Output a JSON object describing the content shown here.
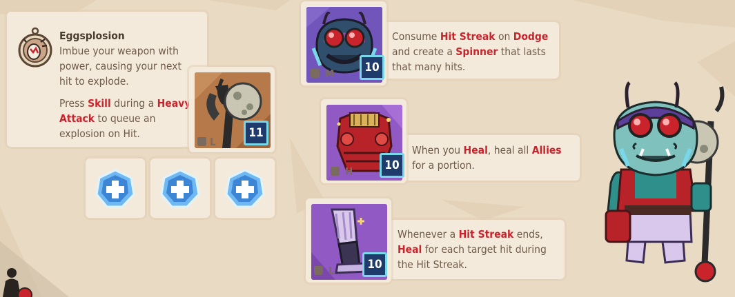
{
  "ability": {
    "title": "Eggsplosion",
    "desc": "Imbue your weapon with power, causing your next hit to explode.",
    "press_pre": "Press ",
    "press_skill": "Skill",
    "press_mid": " during a ",
    "press_heavy": "Heavy Attack",
    "press_post": " to queue an explosion on Hit.",
    "weapon": {
      "weight": "L",
      "level": "11",
      "icon": "egg-mace-weapon-icon"
    }
  },
  "gem_slots": [
    {
      "icon": "blue-plus-gem-icon"
    },
    {
      "icon": "blue-plus-gem-icon"
    },
    {
      "icon": "blue-plus-gem-icon"
    }
  ],
  "gear": [
    {
      "name": "helmet",
      "weight": "M",
      "level": "10",
      "icon": "goggles-helmet-icon",
      "segments": [
        {
          "t": "Consume ",
          "h": false
        },
        {
          "t": "Hit Streak",
          "h": true
        },
        {
          "t": " on ",
          "h": false
        },
        {
          "t": "Dodge",
          "h": true
        },
        {
          "t": " and create a ",
          "h": false
        },
        {
          "t": "Spinner",
          "h": true
        },
        {
          "t": " that lasts that many hits.",
          "h": false
        }
      ]
    },
    {
      "name": "chest",
      "weight": "H",
      "level": "10",
      "icon": "red-armor-chest-icon",
      "segments": [
        {
          "t": "When you ",
          "h": false
        },
        {
          "t": "Heal",
          "h": true
        },
        {
          "t": ", heal all ",
          "h": false
        },
        {
          "t": "Allies",
          "h": true
        },
        {
          "t": " for a portion.",
          "h": false
        }
      ]
    },
    {
      "name": "boots",
      "weight": "L",
      "level": "10",
      "icon": "fur-boots-icon",
      "segments": [
        {
          "t": "Whenever a ",
          "h": false
        },
        {
          "t": "Hit Streak",
          "h": true
        },
        {
          "t": " ends, ",
          "h": false
        },
        {
          "t": "Heal",
          "h": true
        },
        {
          "t": " for each target hit during the Hit Streak.",
          "h": false
        }
      ]
    }
  ],
  "character": {
    "icon": "goblin-character-portrait"
  },
  "corner": {
    "icon": "player-silhouette-icon"
  },
  "colors": {
    "highlight": "#c9232c",
    "panel": "#f4eadb",
    "background": "#e9dac3",
    "level_badge": "#1e3b6b",
    "level_border": "#79d7ea"
  }
}
